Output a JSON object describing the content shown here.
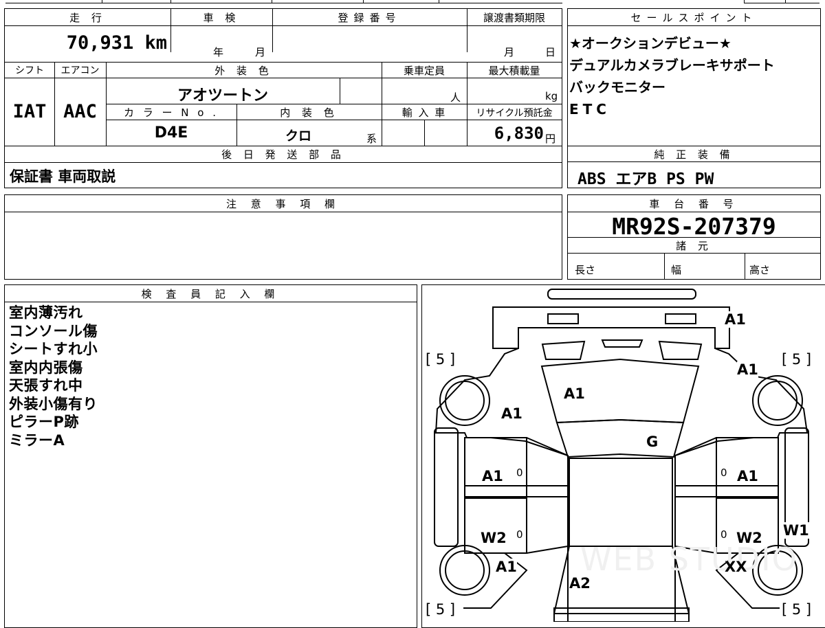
{
  "headers": {
    "mileage": "走 行",
    "inspection": "車 検",
    "registration": "登録番号",
    "transfer_deadline": "譲渡書類期限",
    "sales_points": "セールスポイント",
    "shift": "シフト",
    "aircon": "エアコン",
    "exterior_color": "外 装 色",
    "capacity": "乗車定員",
    "max_load": "最大積載量",
    "color_no": "カ ラ ー N o .",
    "interior_color": "内 装 色",
    "import": "輸 入 車",
    "recycle": "リサイクル預託金",
    "later_parts": "後 日 発 送 部 品",
    "notes": "注 意 事 項 欄",
    "chassis": "車 台 番 号",
    "specs": "諸 元",
    "standard_equipment": "純 正 装 備",
    "inspector": "検 査 員 記 入 欄"
  },
  "values": {
    "mileage": "70,931 km",
    "inspection_year": "年",
    "inspection_month": "月",
    "deadline_month": "月",
    "deadline_day": "日",
    "shift": "IAT",
    "aircon": "AAC",
    "exterior_color": "アオツートン",
    "capacity_unit": "人",
    "load_unit": "kg",
    "color_no": "D4E",
    "interior_color": "クロ",
    "interior_suffix": "系",
    "recycle_amount": "6,830",
    "recycle_unit": "円",
    "later_parts": "保証書 車両取説",
    "chassis": "MR92S-207379",
    "length": "長さ",
    "width": "幅",
    "height": "高さ",
    "standard_equipment": "ABS エアB PS PW"
  },
  "sales_points": [
    "★オークションデビュー★",
    "デュアルカメラブレーキサポート",
    "バックモニター",
    "ETC"
  ],
  "inspector_notes": [
    "室内薄汚れ",
    "コンソール傷",
    "シートすれ小",
    "室内内張傷",
    "天張すれ中",
    "外装小傷有り",
    "ピラーP跡",
    "ミラーA"
  ],
  "diagram": {
    "tire_fl": "[ 5 ]",
    "tire_fr": "[ 5 ]",
    "tire_rl": "[ 5 ]",
    "tire_rr": "[ 5 ]",
    "front_bumper": "A1",
    "front_right_fender": "A1",
    "hood": "A1",
    "left_fender": "A1",
    "windshield": "G",
    "left_front_door": "A1",
    "right_front_door": "A1",
    "left_rear_door": "W2",
    "right_rear_door": "W2",
    "right_side_sill": "W1",
    "left_quarter": "A1",
    "right_quarter": "XX",
    "rear_window": "A2",
    "zero_mark": "0",
    "watermark": "WEB STUDIO"
  }
}
